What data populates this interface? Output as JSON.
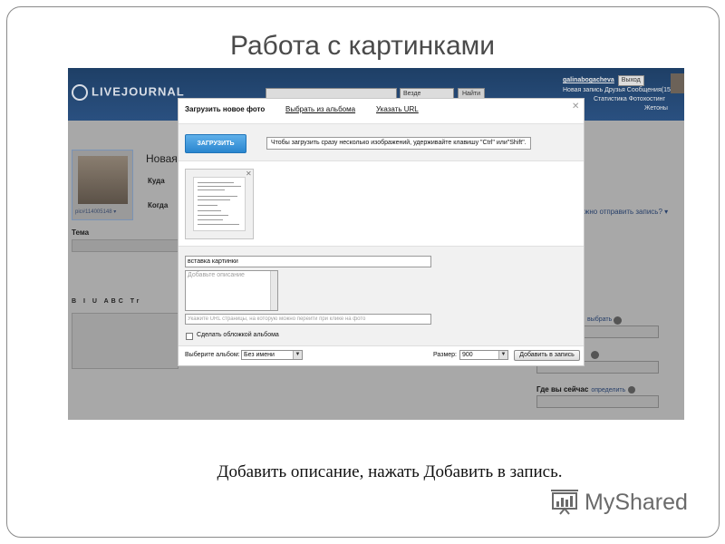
{
  "slide": {
    "title": "Работа с картинками",
    "caption": "Добавить описание, нажать Добавить в запись.",
    "watermark": "MyShared"
  },
  "lj_header": {
    "logo": "LIVEJOURNAL",
    "search_scope": "Везде",
    "search_button": "Найти",
    "username": "galinabogacheva",
    "logout": "Выход",
    "links_row1": "Новая запись  Друзья  Сообщения(15)",
    "links_row2": "Статистика  Фотохостинг",
    "links_row3": "Жетоны"
  },
  "bg_editor": {
    "new_entry": "Новая",
    "to_label": "Куда",
    "when_label": "Когда",
    "userpic_label": "pic#114005148 ▾",
    "subject_label": "Тема",
    "toolbar": "B I U ABC Tr",
    "right_link": "жно отправить запись? ▾",
    "define_link": "выбрать",
    "where_label": "Где вы сейчас",
    "where_link": "определить"
  },
  "dialog": {
    "tabs": {
      "upload": "Загрузить новое фото",
      "album": "Выбрать из альбома",
      "url": "Указать URL"
    },
    "upload_button": "ЗАГРУЗИТЬ",
    "upload_hint": "Чтобы загрузить сразу несколько изображений, удерживайте клавишу \"Ctrl\" или\"Shift\".",
    "title_value": "вставка картинки",
    "description_placeholder": "Добавьте описание",
    "url_placeholder": "Укажите URL страницы, на которую можно перейти при клике на фото",
    "cover_label": "Сделать обложкой альбома",
    "album_label": "Выберите альбом:",
    "album_value": "Без имени",
    "size_label": "Размер:",
    "size_value": "900",
    "insert_button": "Добавить в запись"
  },
  "colors": {
    "upload_button": "#3a96dc",
    "overlay": "#a8a8a8",
    "header": "#1e3f66"
  },
  "icons": {
    "close": "close-icon",
    "thumb_close": "thumb-close-icon",
    "dropdown": "chevron-down-icon",
    "watermark": "presentation-board-icon"
  }
}
